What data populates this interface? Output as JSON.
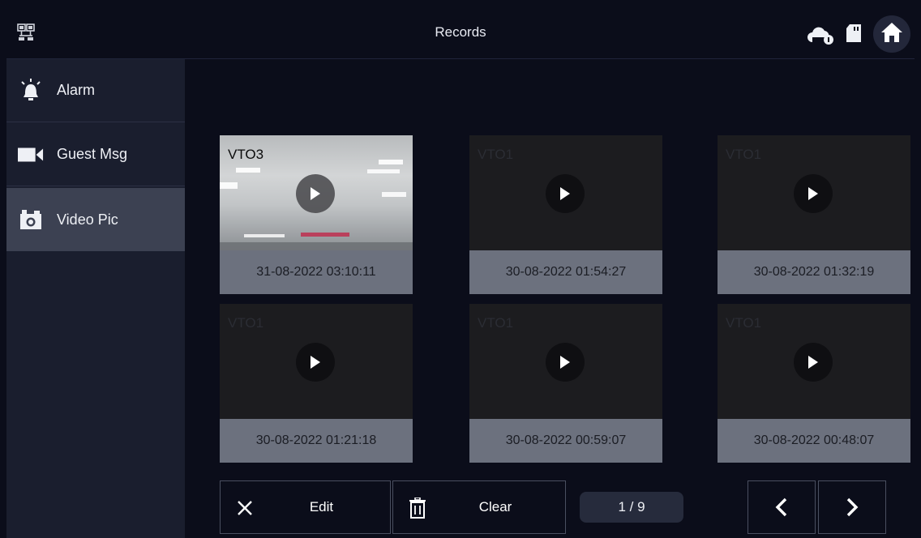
{
  "header": {
    "title": "Records",
    "icons": [
      "network-icon",
      "cloud-icon",
      "sd-card-icon",
      "home-icon"
    ]
  },
  "sidebar": {
    "items": [
      {
        "label": "Alarm",
        "icon": "alarm-bell-icon",
        "active": false
      },
      {
        "label": "Guest Msg",
        "icon": "video-camera-icon",
        "active": false
      },
      {
        "label": "Video Pic",
        "icon": "camera-icon",
        "active": true
      }
    ]
  },
  "records": [
    {
      "camera": "VTO3",
      "timestamp": "31-08-2022 03:10:11",
      "has_snapshot": true
    },
    {
      "camera": "VTO1",
      "timestamp": "30-08-2022 01:54:27",
      "has_snapshot": false
    },
    {
      "camera": "VTO1",
      "timestamp": "30-08-2022 01:32:19",
      "has_snapshot": false
    },
    {
      "camera": "VTO1",
      "timestamp": "30-08-2022 01:21:18",
      "has_snapshot": false
    },
    {
      "camera": "VTO1",
      "timestamp": "30-08-2022 00:59:07",
      "has_snapshot": false
    },
    {
      "camera": "VTO1",
      "timestamp": "30-08-2022 00:48:07",
      "has_snapshot": false
    }
  ],
  "toolbar": {
    "edit_label": "Edit",
    "clear_label": "Clear",
    "page_indicator": "1 / 9",
    "prev_icon": "chevron-left-icon",
    "next_icon": "chevron-right-icon"
  },
  "colors": {
    "background": "#0b0d1a",
    "sidebar": "#1a1e2e",
    "sidebar_active": "#3c4152",
    "timestamp_bar": "#6c717e",
    "page_indicator": "#262b3c"
  }
}
